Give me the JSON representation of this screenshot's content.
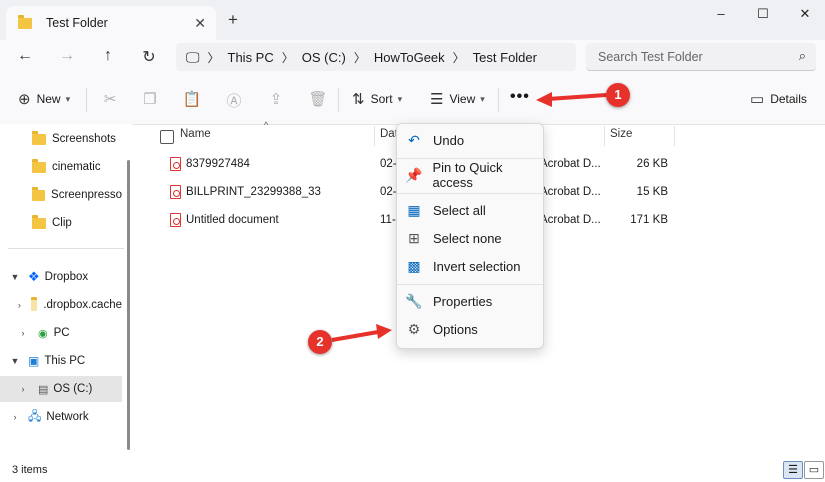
{
  "window": {
    "tab_title": "Test Folder",
    "new_tab_glyph": "+",
    "controls": {
      "minimize": "–",
      "maximize": "☐",
      "close": "✕"
    }
  },
  "address": {
    "crumbs": [
      "This PC",
      "OS (C:)",
      "HowToGeek",
      "Test Folder"
    ],
    "search_placeholder": "Search Test Folder"
  },
  "toolbar": {
    "new_label": "New",
    "sort_label": "Sort",
    "view_label": "View",
    "more_glyph": "•••",
    "details_label": "Details"
  },
  "sidebar": {
    "items": [
      {
        "label": "Screenshots"
      },
      {
        "label": "cinematic"
      },
      {
        "label": "Screenpresso"
      },
      {
        "label": "Clip"
      },
      {
        "label": "Dropbox"
      },
      {
        "label": ".dropbox.cache"
      },
      {
        "label": "PC"
      },
      {
        "label": "This PC"
      },
      {
        "label": "OS (C:)"
      },
      {
        "label": "Network"
      }
    ]
  },
  "columns": {
    "name": "Name",
    "date": "Dat",
    "type": "",
    "size": "Size"
  },
  "files": [
    {
      "name": "8379927484",
      "date": "02-",
      "type": "Acrobat D...",
      "size": "26 KB"
    },
    {
      "name": "BILLPRINT_23299388_33",
      "date": "02-",
      "type": "Acrobat D...",
      "size": "15 KB"
    },
    {
      "name": "Untitled document",
      "date": "11-",
      "type": "Acrobat D...",
      "size": "171 KB"
    }
  ],
  "context_menu": {
    "items": [
      {
        "label": "Undo",
        "icon": "undo-icon"
      },
      {
        "label": "Pin to Quick access",
        "icon": "pin-icon"
      },
      {
        "label": "Select all",
        "icon": "select-all-icon"
      },
      {
        "label": "Select none",
        "icon": "select-none-icon"
      },
      {
        "label": "Invert selection",
        "icon": "invert-selection-icon"
      },
      {
        "label": "Properties",
        "icon": "wrench-icon"
      },
      {
        "label": "Options",
        "icon": "gear-icon"
      }
    ]
  },
  "status": {
    "item_count": "3 items"
  },
  "annotations": {
    "badge_1": "1",
    "badge_2": "2",
    "arrow_color": "#e6322b"
  },
  "colors": {
    "accent": "#0067c0",
    "folder": "#f4c542",
    "pdf": "#d33333"
  }
}
